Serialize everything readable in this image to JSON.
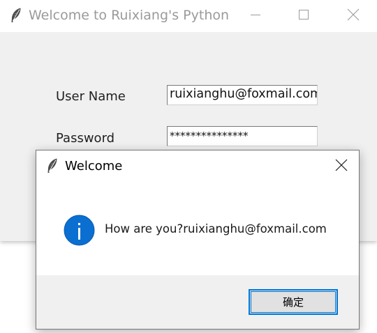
{
  "main_window": {
    "title": "Welcome to Ruixiang's Python",
    "icon": "feather-icon",
    "controls": {
      "minimize_icon": "minimize-icon",
      "maximize_icon": "maximize-icon",
      "close_icon": "close-icon"
    },
    "form": {
      "username_label": "User Name",
      "username_value": "ruixianghu@foxmail.com",
      "password_label": "Password",
      "password_value": "***************"
    }
  },
  "dialog": {
    "title": "Welcome",
    "icon": "info-icon",
    "message": "How are you?ruixianghu@foxmail.com",
    "ok_label": "确定"
  },
  "colors": {
    "accent": "#0078d7",
    "window_bg": "#f0f0f0",
    "info_icon": "#0a6fd1"
  }
}
